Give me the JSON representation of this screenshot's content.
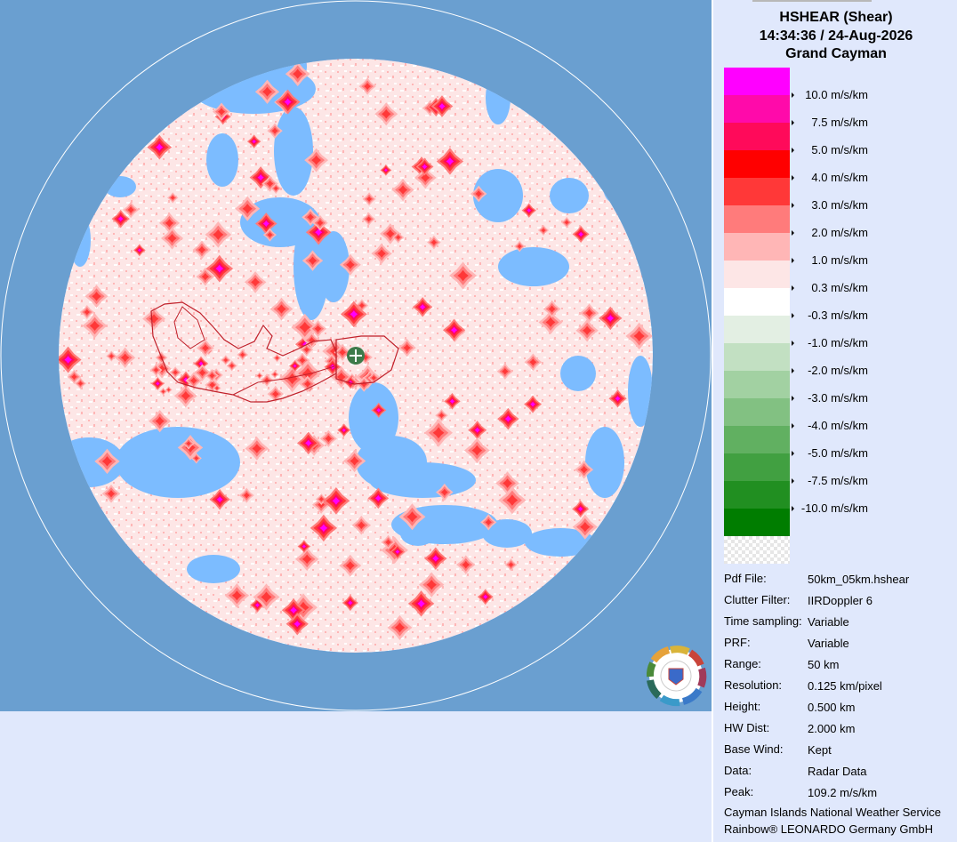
{
  "header": {
    "product": "HSHEAR (Shear)",
    "datetime": "14:34:36 / 24-Aug-2026",
    "site": "Grand Cayman"
  },
  "legend": [
    {
      "label": "",
      "color": "#ff00ff"
    },
    {
      "label": "10.0 m/s/km",
      "color": "#ff0aaa"
    },
    {
      "label": "7.5 m/s/km",
      "color": "#ff0a5a"
    },
    {
      "label": "5.0 m/s/km",
      "color": "#ff0000"
    },
    {
      "label": "4.0 m/s/km",
      "color": "#ff3838"
    },
    {
      "label": "3.0 m/s/km",
      "color": "#ff7b7b"
    },
    {
      "label": "2.0 m/s/km",
      "color": "#ffb6b6"
    },
    {
      "label": "1.0 m/s/km",
      "color": "#fde6e6"
    },
    {
      "label": "0.3 m/s/km",
      "color": "#ffffff"
    },
    {
      "label": "-0.3 m/s/km",
      "color": "#e3efe3"
    },
    {
      "label": "-1.0 m/s/km",
      "color": "#c2e0c2"
    },
    {
      "label": "-2.0 m/s/km",
      "color": "#a2d1a2"
    },
    {
      "label": "-3.0 m/s/km",
      "color": "#82c182"
    },
    {
      "label": "-4.0 m/s/km",
      "color": "#61b061"
    },
    {
      "label": "-5.0 m/s/km",
      "color": "#41a041"
    },
    {
      "label": "-7.5 m/s/km",
      "color": "#218f21"
    },
    {
      "label": "-10.0 m/s/km",
      "color": "#007d00"
    },
    {
      "label": "",
      "color": "none"
    }
  ],
  "info": [
    {
      "key": "Pdf File:",
      "value": "50km_05km.hshear"
    },
    {
      "key": "Clutter Filter:",
      "value": "IIRDoppler 6"
    },
    {
      "key": "Time sampling:",
      "value": "Variable"
    },
    {
      "key": "PRF:",
      "value": "Variable"
    },
    {
      "key": "Range:",
      "value": "50 km"
    },
    {
      "key": "Resolution:",
      "value": "0.125 km/pixel"
    },
    {
      "key": "Height:",
      "value": "0.500 km"
    },
    {
      "key": "HW Dist:",
      "value": "2.000 km"
    },
    {
      "key": "Base Wind:",
      "value": "Kept"
    },
    {
      "key": "Data:",
      "value": "Radar Data"
    },
    {
      "key": "Peak:",
      "value": "109.2 m/s/km"
    }
  ],
  "credits": {
    "line1": "Cayman Islands National Weather Service",
    "line2": "Rainbow® LEONARDO Germany GmbH"
  },
  "colors": {
    "background": "#6a9fd0",
    "no_data": "#7cbcff",
    "panel": "#e0e8fc",
    "coastline": "#c0202a",
    "radar_site": "#3d7a4a"
  },
  "icons": {
    "radar_site": "radar-site-icon",
    "logo": "nws-logo-icon"
  }
}
